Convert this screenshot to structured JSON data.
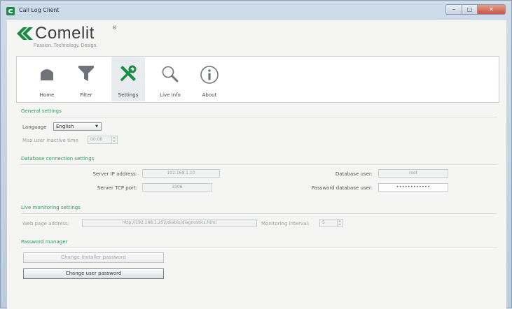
{
  "window": {
    "title": "Call Log Client",
    "controls": {
      "minimize": "–",
      "maximize": "□",
      "close": "✕"
    }
  },
  "brand": {
    "name": "Comelit",
    "registered": "®",
    "tagline": "Passion. Technology. Design.",
    "accent_color": "#1a8c45"
  },
  "toolbar": {
    "items": [
      {
        "label": "Home",
        "icon": "home-icon"
      },
      {
        "label": "Filter",
        "icon": "filter-icon"
      },
      {
        "label": "Settings",
        "icon": "settings-icon",
        "active": true
      },
      {
        "label": "Live info",
        "icon": "magnifier-icon"
      },
      {
        "label": "About",
        "icon": "info-icon"
      }
    ]
  },
  "general": {
    "title": "General settings",
    "language_label": "Language",
    "language_value": "English",
    "inactive_label": "Max user inactive time",
    "inactive_value": "00:00"
  },
  "database": {
    "title": "Database connection settings",
    "server_ip_label": "Server IP address:",
    "server_ip_value": "192.168.1.10",
    "server_tcp_label": "Server TCP port:",
    "server_tcp_value": "3306",
    "db_user_label": "Database user:",
    "db_user_value": "root",
    "db_password_label": "Password database user:",
    "db_password_value": "••••••••••••"
  },
  "live": {
    "title": "Live monitoring settings",
    "web_page_label": "Web page address:",
    "web_page_value": "http://192.168.1.252/diablo/diagnostics.html",
    "interval_label": "Monitoring interval:",
    "interval_value": "5"
  },
  "password": {
    "title": "Password manager",
    "installer_button": "Change installer password",
    "user_button": "Change user password"
  }
}
